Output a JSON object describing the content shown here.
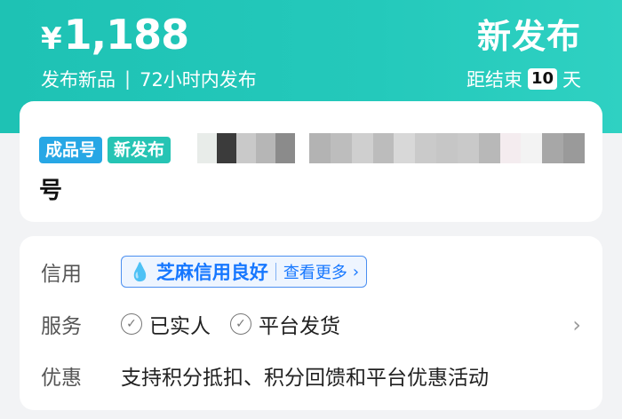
{
  "hero": {
    "currency": "¥",
    "price": "1,188",
    "subtitle_left": "发布新品",
    "subtitle_sep": "|",
    "subtitle_right": "72小时内发布",
    "badge": "新发布",
    "countdown_prefix": "距结束",
    "countdown_days": "10",
    "countdown_suffix": "天"
  },
  "title_card": {
    "tags": [
      "成品号",
      "新发布"
    ],
    "title_tail": "号"
  },
  "info": {
    "credit": {
      "label": "信用",
      "value": "芝麻信用良好",
      "more": "查看更多"
    },
    "service": {
      "label": "服务",
      "items": [
        "已实人",
        "平台发货"
      ]
    },
    "promo": {
      "label": "优惠",
      "value": "支持积分抵扣、积分回馈和平台优惠活动"
    }
  },
  "colors": {
    "hero_bg": "#24c9bb",
    "tag_blue": "#27a7e5",
    "tag_teal": "#26c4b4",
    "credit_blue": "#1677ff"
  },
  "icons": [
    "water-drop-icon",
    "chevron-right-icon",
    "check-circle-icon"
  ]
}
